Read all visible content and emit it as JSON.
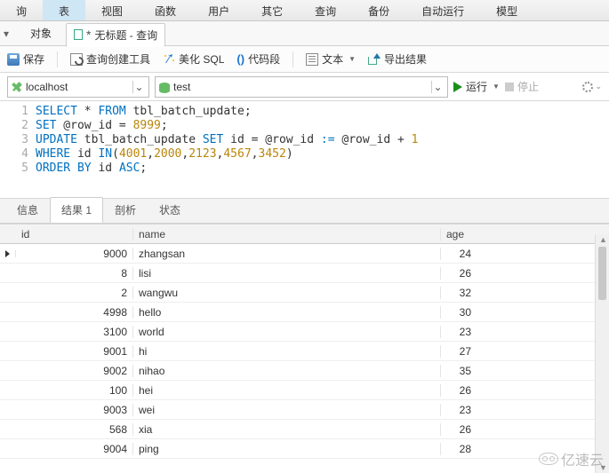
{
  "menu": [
    "询",
    "表",
    "视图",
    "函数",
    "用户",
    "其它",
    "查询",
    "备份",
    "自动运行",
    "模型"
  ],
  "menu_active_index": 1,
  "tabs": {
    "objects": "对象",
    "query_title": "无标题 - 查询"
  },
  "toolbar": {
    "save": "保存",
    "explain": "查询创建工具",
    "beautify": "美化 SQL",
    "snippet": "代码段",
    "text": "文本",
    "export": "导出结果"
  },
  "conn": {
    "host": "localhost",
    "db": "test",
    "run": "运行",
    "stop": "停止"
  },
  "sql": {
    "lines": [
      {
        "n": "1",
        "raw": "SELECT * FROM tbl_batch_update;"
      },
      {
        "n": "2",
        "raw": "SET @row_id = 8999;"
      },
      {
        "n": "3",
        "raw": "UPDATE tbl_batch_update SET id = @row_id := @row_id + 1"
      },
      {
        "n": "4",
        "raw": "WHERE id IN(4001,2000,2123,4567,3452)"
      },
      {
        "n": "5",
        "raw": "ORDER BY id ASC;"
      }
    ]
  },
  "bottom_tabs": [
    "信息",
    "结果 1",
    "剖析",
    "状态"
  ],
  "bottom_active": 1,
  "columns": {
    "id": "id",
    "name": "name",
    "age": "age"
  },
  "rows": [
    {
      "id": "9000",
      "name": "zhangsan",
      "age": "24"
    },
    {
      "id": "8",
      "name": "lisi",
      "age": "26"
    },
    {
      "id": "2",
      "name": "wangwu",
      "age": "32"
    },
    {
      "id": "4998",
      "name": "hello",
      "age": "30"
    },
    {
      "id": "3100",
      "name": "world",
      "age": "23"
    },
    {
      "id": "9001",
      "name": "hi",
      "age": "27"
    },
    {
      "id": "9002",
      "name": "nihao",
      "age": "35"
    },
    {
      "id": "100",
      "name": "hei",
      "age": "26"
    },
    {
      "id": "9003",
      "name": "wei",
      "age": "23"
    },
    {
      "id": "568",
      "name": "xia",
      "age": "26"
    },
    {
      "id": "9004",
      "name": "ping",
      "age": "28"
    }
  ],
  "watermark": "亿速云"
}
